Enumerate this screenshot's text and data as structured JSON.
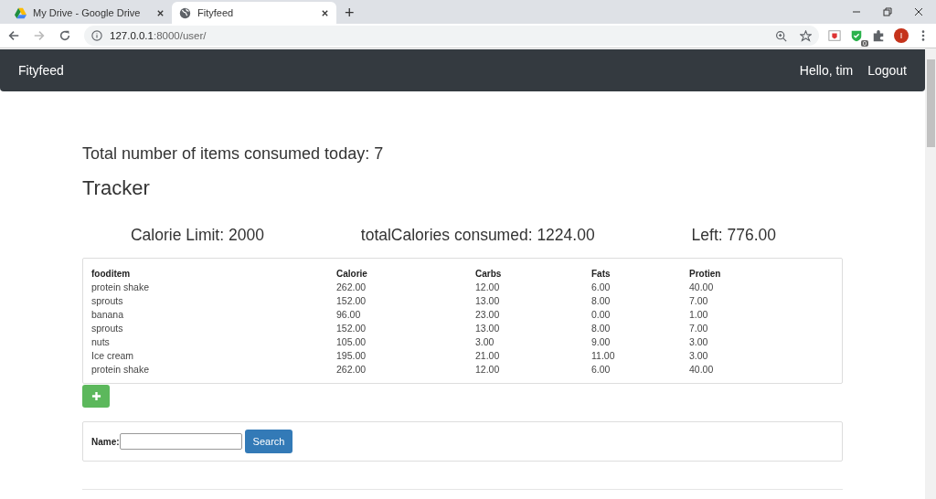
{
  "browser": {
    "tabs": [
      {
        "title": "My Drive - Google Drive",
        "selected": false
      },
      {
        "title": "Fityfeed",
        "selected": true
      }
    ],
    "new_tab": "+",
    "address": {
      "host": "127.0.0.1",
      "path": ":8000/user/"
    },
    "extension_badge": "0",
    "profile_initial": "I"
  },
  "navbar": {
    "brand": "Fityfeed",
    "greeting": "Hello, tim",
    "logout": "Logout"
  },
  "summary": "Total number of items consumed today: 7",
  "heading": "Tracker",
  "stats": [
    "Calorie Limit: 2000",
    "totalCalories consumed: 1224.00",
    "Left: 776.00"
  ],
  "table": {
    "columns": [
      "fooditem",
      "Calorie",
      "Carbs",
      "Fats",
      "Protien"
    ],
    "rows": [
      [
        "protein shake",
        "262.00",
        "12.00",
        "6.00",
        "40.00"
      ],
      [
        "sprouts",
        "152.00",
        "13.00",
        "8.00",
        "7.00"
      ],
      [
        "banana",
        "96.00",
        "23.00",
        "0.00",
        "1.00"
      ],
      [
        "sprouts",
        "152.00",
        "13.00",
        "8.00",
        "7.00"
      ],
      [
        "nuts",
        "105.00",
        "3.00",
        "9.00",
        "3.00"
      ],
      [
        "Ice cream",
        "195.00",
        "21.00",
        "11.00",
        "3.00"
      ],
      [
        "protein shake",
        "262.00",
        "12.00",
        "6.00",
        "40.00"
      ]
    ]
  },
  "search": {
    "label": "Name:",
    "button": "Search"
  }
}
